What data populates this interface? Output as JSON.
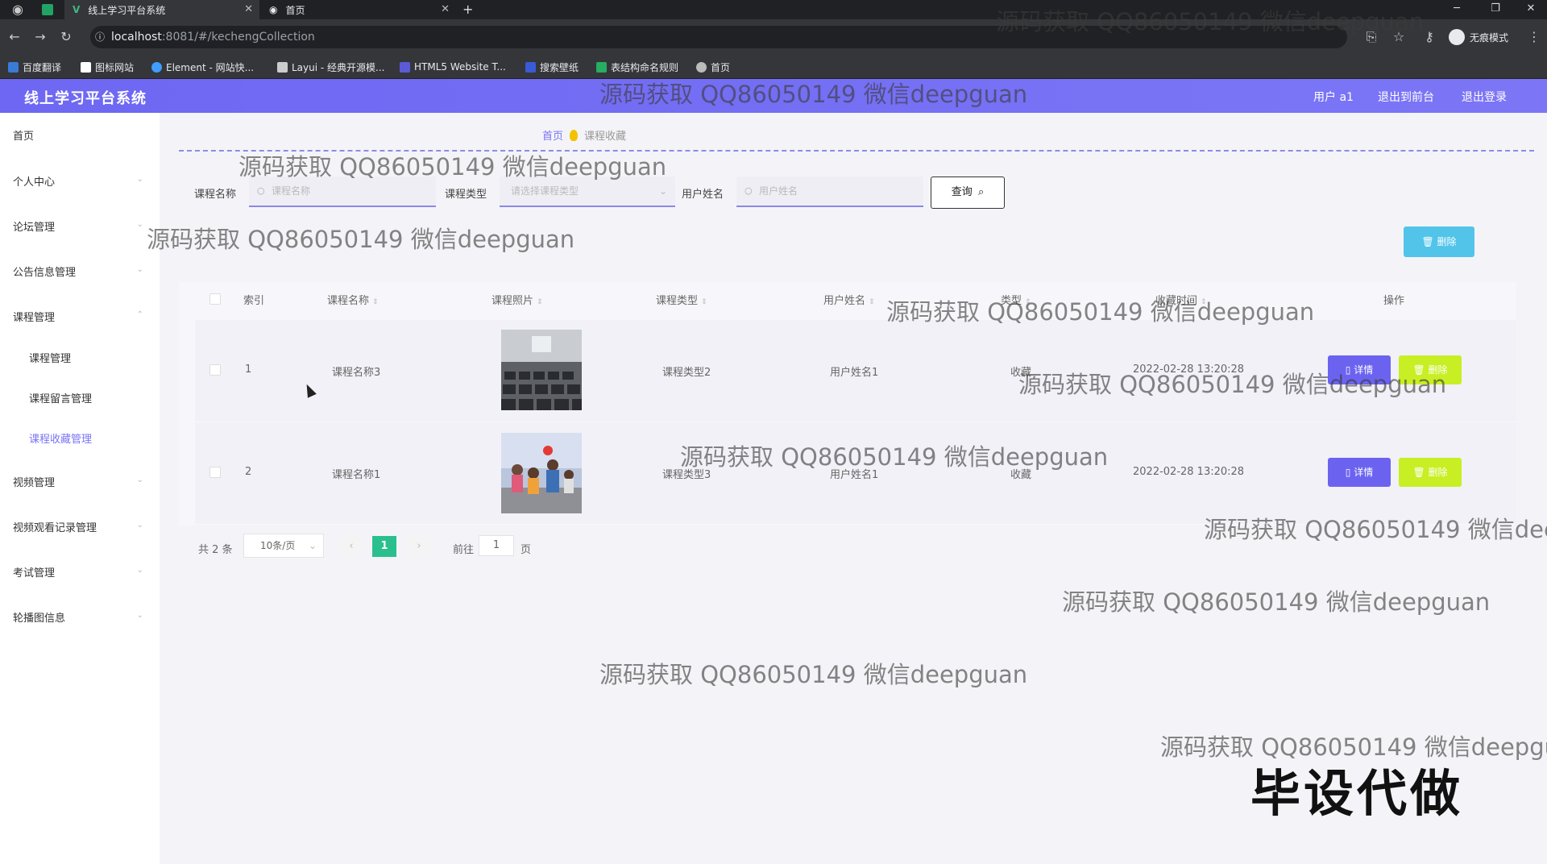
{
  "browser": {
    "tabs": [
      {
        "title": "线上学习平台系统",
        "active": true
      },
      {
        "title": "首页",
        "active": false
      }
    ],
    "new_tab": "+",
    "url_host": "localhost",
    "url_path": ":8081/#/kechengCollection",
    "profile": "无痕模式",
    "bookmarks": [
      {
        "label": "百度翻译",
        "color": "#3a7bd5"
      },
      {
        "label": "图标网站",
        "color": "#ffffff"
      },
      {
        "label": "Element - 网站快...",
        "color": "#409eff"
      },
      {
        "label": "Layui - 经典开源模...",
        "color": "#cccccc"
      },
      {
        "label": "HTML5 Website T...",
        "color": "#5b5bd6"
      },
      {
        "label": "搜索壁纸",
        "color": "#3a5bd5"
      },
      {
        "label": "表结构命名规则",
        "color": "#27ae60"
      },
      {
        "label": "首页",
        "color": "#bbbbbb"
      }
    ]
  },
  "header": {
    "title": "线上学习平台系统",
    "user": "用户 a1",
    "to_front": "退出到前台",
    "logout": "退出登录"
  },
  "sidebar": {
    "items": [
      {
        "label": "首页"
      },
      {
        "label": "个人中心"
      },
      {
        "label": "论坛管理"
      },
      {
        "label": "公告信息管理"
      },
      {
        "label": "课程管理"
      },
      {
        "label": "课程管理"
      },
      {
        "label": "课程留言管理"
      },
      {
        "label": "课程收藏管理"
      },
      {
        "label": "视频管理"
      },
      {
        "label": "视频观看记录管理"
      },
      {
        "label": "考试管理"
      },
      {
        "label": "轮播图信息"
      }
    ]
  },
  "breadcrumb": {
    "home": "首页",
    "current": "课程收藏"
  },
  "search": {
    "name_label": "课程名称",
    "name_placeholder": "课程名称",
    "type_label": "课程类型",
    "type_placeholder": "请选择课程类型",
    "user_label": "用户姓名",
    "user_placeholder": "用户姓名",
    "query_button": "查询"
  },
  "delete_button": "删除",
  "table": {
    "columns": [
      "索引",
      "课程名称",
      "课程照片",
      "课程类型",
      "用户姓名",
      "类型",
      "收藏时间",
      "操作"
    ],
    "rows": [
      {
        "index": "1",
        "course_name": "课程名称3",
        "course_type": "课程类型2",
        "user_name": "用户姓名1",
        "type": "收藏",
        "time": "2022-02-28 13:20:28",
        "detail": "详情",
        "delete": "删除"
      },
      {
        "index": "2",
        "course_name": "课程名称1",
        "course_type": "课程类型3",
        "user_name": "用户姓名1",
        "type": "收藏",
        "time": "2022-02-28 13:20:28",
        "detail": "详情",
        "delete": "删除"
      }
    ]
  },
  "pagination": {
    "total": "共 2 条",
    "page_size": "10条/页",
    "current_page": "1",
    "goto": "前往",
    "goto_value": "1",
    "page_unit": "页"
  },
  "watermark": "源码获取 QQ86050149 微信deepguan",
  "big_watermark": "毕设代做"
}
